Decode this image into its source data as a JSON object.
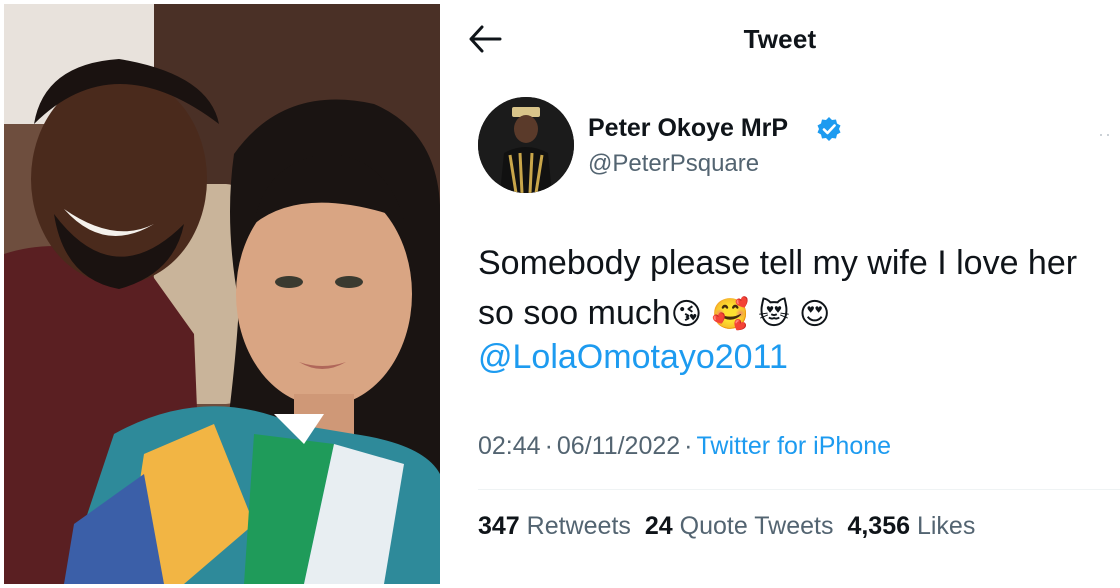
{
  "header": {
    "title": "Tweet",
    "back_icon": "arrow-left-icon"
  },
  "author": {
    "display_name": "Peter Okoye MrP",
    "handle": "@PeterPsquare",
    "verified_icon": "verified-badge-icon"
  },
  "tweet": {
    "text": "Somebody please tell my wife I love her so soo much",
    "emojis": [
      "😘",
      "🥰",
      "😻",
      "😍"
    ],
    "mention": "@LolaOmotayo2011"
  },
  "meta": {
    "time": "02:44",
    "separator": "·",
    "date": "06/11/2022",
    "source": "Twitter for iPhone"
  },
  "stats": {
    "retweets_count": "347",
    "retweets_label": "Retweets",
    "quotes_count": "24",
    "quotes_label": "Quote Tweets",
    "likes_count": "4,356",
    "likes_label": "Likes"
  },
  "colors": {
    "accent": "#1d9bf0",
    "text_primary": "#0f1419",
    "text_secondary": "#536471"
  }
}
